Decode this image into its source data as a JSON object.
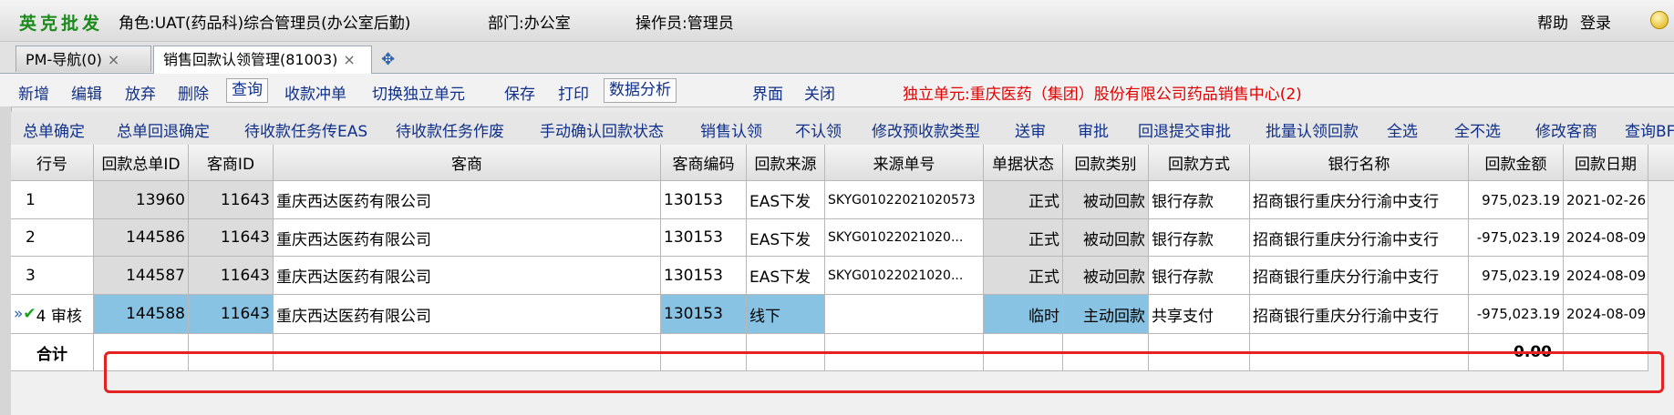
{
  "titlebar": {
    "brand": "英克批发",
    "role": "角色:UAT(药品科)综合管理员(办公室后勤)",
    "dept": "部门:办公室",
    "operator": "操作员:管理员",
    "help": "帮助",
    "login": "登录"
  },
  "tabs": [
    {
      "label": "PM-导航(0)",
      "close": "×"
    },
    {
      "label": "销售回款认领管理(81003)",
      "close": "×"
    }
  ],
  "toolbar1": {
    "add": "新增",
    "edit": "编辑",
    "discard": "放弃",
    "delete": "删除",
    "query": "查询",
    "offset": "收款冲单",
    "switch_unit": "切换独立单元",
    "save": "保存",
    "print": "打印",
    "analysis": "数据分析",
    "interface": "界面",
    "close": "关闭",
    "unit_info": "独立单元:重庆医药（集团）股份有限公司药品销售中心(2)"
  },
  "toolbar2": [
    "总单确定",
    "总单回退确定",
    "待收款任务传EAS",
    "待收款任务作废",
    "手动确认回款状态",
    "销售认领",
    "不认领",
    "修改预收款类型",
    "送审",
    "审批",
    "回退提交审批",
    "批量认领回款",
    "全选",
    "全不选",
    "修改客商",
    "查询BF"
  ],
  "table": {
    "headers": [
      "行号",
      "回款总单ID",
      "客商ID",
      "客商",
      "客商编码",
      "回款来源",
      "来源单号",
      "单据状态",
      "回款类别",
      "回款方式",
      "银行名称",
      "回款金额",
      "回款日期"
    ],
    "rows": [
      [
        "1",
        "13960",
        "11643",
        "重庆西达医药有限公司",
        "130153",
        "EAS下发",
        "SKYG01022021020573",
        "正式",
        "被动回款",
        "银行存款",
        "招商银行重庆分行渝中支行",
        "975,023.19",
        "2021-02-26"
      ],
      [
        "2",
        "144586",
        "11643",
        "重庆西达医药有限公司",
        "130153",
        "EAS下发",
        "SKYG01022021020...",
        "正式",
        "被动回款",
        "银行存款",
        "招商银行重庆分行渝中支行",
        "-975,023.19",
        "2024-08-09"
      ],
      [
        "3",
        "144587",
        "11643",
        "重庆西达医药有限公司",
        "130153",
        "EAS下发",
        "SKYG01022021020...",
        "正式",
        "被动回款",
        "银行存款",
        "招商银行重庆分行渝中支行",
        "975,023.19",
        "2024-08-09"
      ],
      [
        "4 审核",
        "144588",
        "11643",
        "重庆西达医药有限公司",
        "130153",
        "线下",
        "",
        "临时",
        "主动回款",
        "共享支付",
        "招商银行重庆分行渝中支行",
        "-975,023.19",
        "2024-08-09"
      ]
    ],
    "total_label": "合计",
    "total_amount": "0.00"
  }
}
